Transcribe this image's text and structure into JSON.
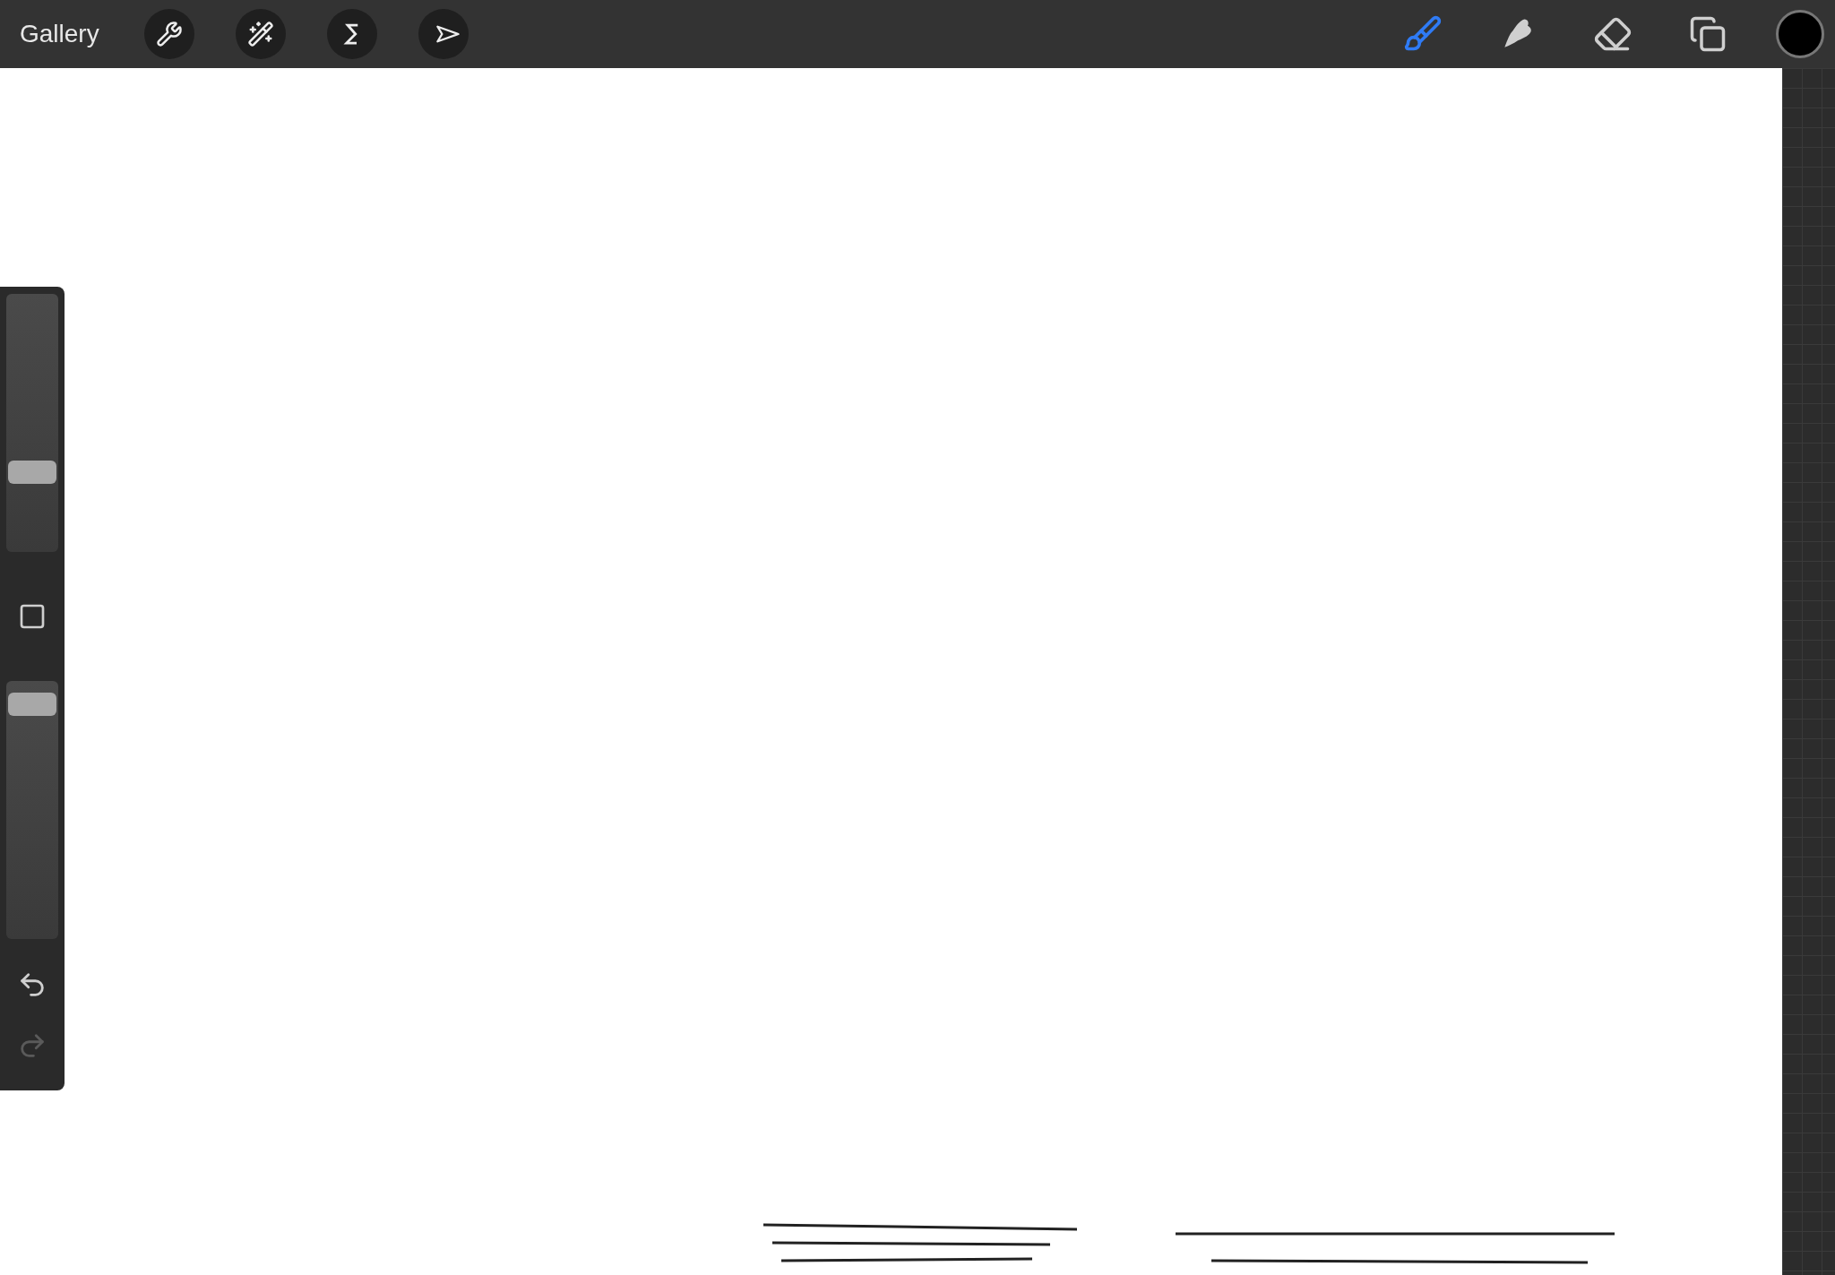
{
  "toolbar": {
    "gallery": "Gallery",
    "left_tools": [
      {
        "kind": "actions",
        "selected": false
      },
      {
        "kind": "adjustments",
        "selected": false
      },
      {
        "kind": "selection",
        "selected": false
      },
      {
        "kind": "transform",
        "selected": false
      }
    ],
    "right_tools": [
      {
        "kind": "brush",
        "selected": true
      },
      {
        "kind": "smudge",
        "selected": false
      },
      {
        "kind": "eraser",
        "selected": false
      },
      {
        "kind": "layers",
        "selected": false
      }
    ],
    "color": "#000000"
  },
  "sidebar": {
    "brush_size": {
      "level": 0.29
    },
    "opacity": {
      "level": 0.95
    },
    "undo": {
      "disabled": false
    },
    "redo": {
      "disabled": true
    }
  }
}
